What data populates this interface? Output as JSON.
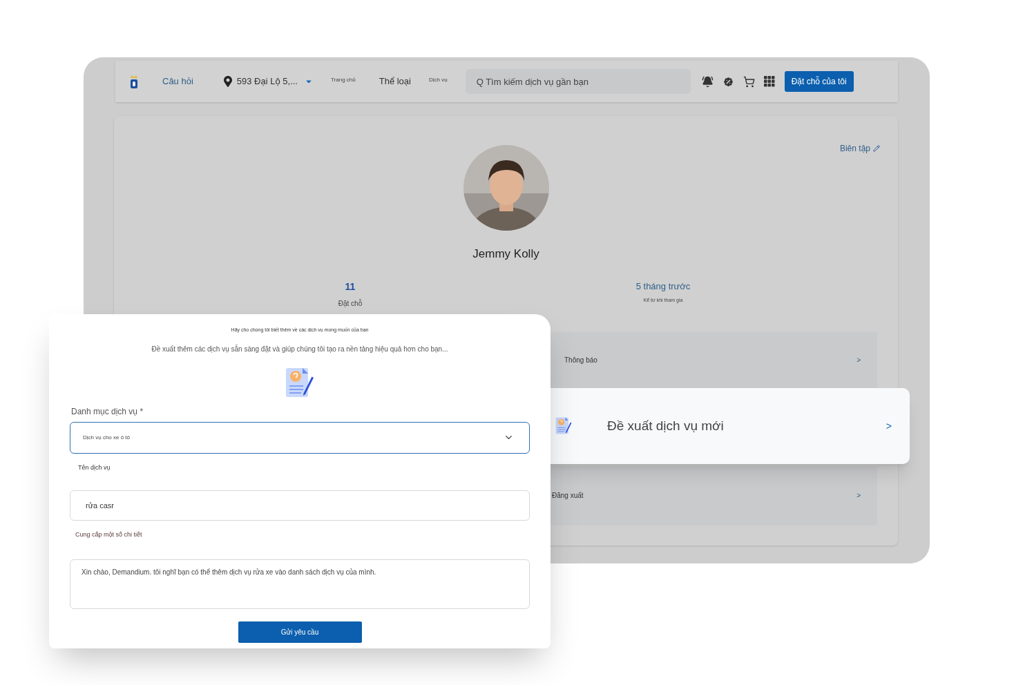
{
  "navbar": {
    "links": [
      {
        "label": "Câu hỏi",
        "kind": "link"
      },
      {
        "label": "593 Đại Lộ 5,...",
        "kind": "location"
      },
      {
        "label": "Trang chủ",
        "kind": "small"
      },
      {
        "label": "Thể loại",
        "kind": "link"
      },
      {
        "label": "Dịch vụ",
        "kind": "small"
      }
    ],
    "search": {
      "placeholder": "Q Tìm kiếm dịch vụ gần bạn"
    },
    "button": "Đặt chỗ của tôi"
  },
  "profile": {
    "edit_label": "Biên tập",
    "name": "Jemmy Kolly",
    "stats": [
      {
        "value": "11",
        "label": "Đặt chỗ",
        "kind": "count"
      },
      {
        "value": "5 tháng trước",
        "label": "Kể từ khi tham gia",
        "kind": "text"
      }
    ],
    "menu": [
      {
        "label": "Thông báo",
        "arrow": ">"
      },
      {
        "label": "Đăng xuất",
        "arrow": ">"
      }
    ]
  },
  "highlight_card": {
    "label": "Đề xuất dịch vụ mới",
    "arrow": ">"
  },
  "form": {
    "heading": "Hãy cho chúng tôi biết thêm về các dịch vụ mong muốn của bạn",
    "subtitle": "Đề xuất thêm các dịch vụ sẵn sàng đặt và giúp chúng tôi tạo ra nền tảng hiệu quả hơn cho bạn...",
    "category_label": "Danh mục dịch vụ *",
    "category_value": "Dịch vụ cho xe ô tô",
    "name_label": "Tên dịch vụ",
    "name_value": "rửa casr",
    "details_label": "Cung cấp một số chi tiết",
    "details_value": "Xin chào, Demandium. tôi nghĩ bạn có thể thêm dịch vụ rửa xe vào danh sách dịch vụ của mình.",
    "submit": "Gửi yêu cầu"
  }
}
